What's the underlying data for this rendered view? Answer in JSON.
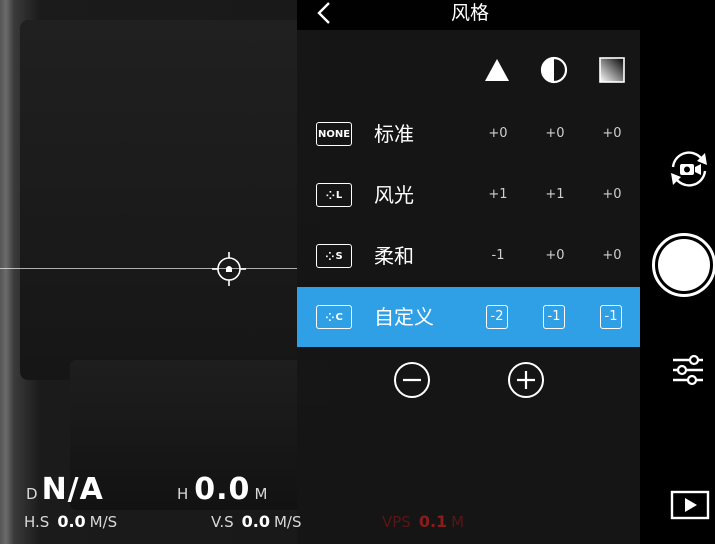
{
  "header": {
    "title": "风格"
  },
  "columns": [
    {
      "icon": "sharpness-icon"
    },
    {
      "icon": "contrast-icon"
    },
    {
      "icon": "saturation-icon"
    }
  ],
  "styles": [
    {
      "icon_text": "NONE",
      "name": "标准",
      "values": [
        "+0",
        "+0",
        "+0"
      ],
      "selected": false
    },
    {
      "icon_text": "L",
      "name": "风光",
      "values": [
        "+1",
        "+1",
        "+0"
      ],
      "selected": false
    },
    {
      "icon_text": "S",
      "name": "柔和",
      "values": [
        "-1",
        "+0",
        "+0"
      ],
      "selected": false
    },
    {
      "icon_text": "C",
      "name": "自定义",
      "values": [
        "-2",
        "-1",
        "-1"
      ],
      "selected": true
    }
  ],
  "controls": {
    "decrease": "minus-icon",
    "increase": "plus-icon"
  },
  "telemetry": {
    "d": {
      "label": "D",
      "value": "N/A"
    },
    "h": {
      "label": "H",
      "value": "0.0",
      "unit": "M"
    },
    "hs": {
      "label": "H.S",
      "value": "0.0",
      "unit": "M/S"
    },
    "vs": {
      "label": "V.S",
      "value": "0.0",
      "unit": "M/S"
    },
    "vps": {
      "label": "VPS",
      "value": "0.1",
      "unit": "M"
    }
  },
  "colors": {
    "accent": "#2f9fe6",
    "warning": "#8a1c1c"
  }
}
